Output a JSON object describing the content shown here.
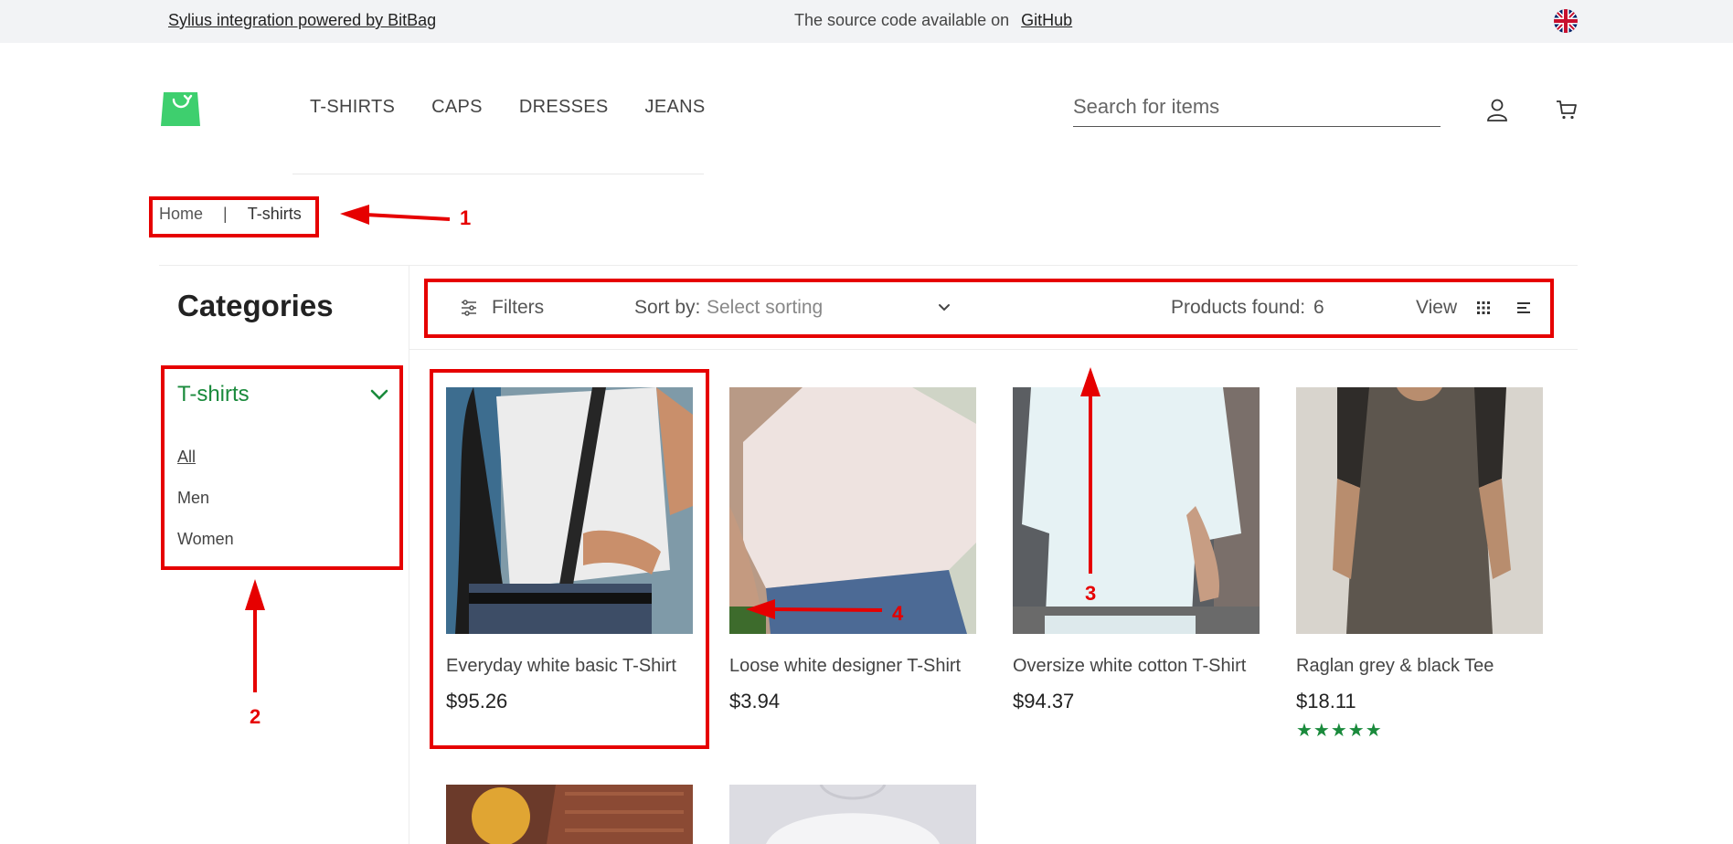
{
  "topbar": {
    "left_link": "Sylius integration powered by BitBag",
    "center_text": "The source code available on",
    "center_link": "GitHub",
    "language_icon": "uk-flag-icon"
  },
  "header": {
    "logo_icon": "shopping-bag-logo-icon",
    "nav": [
      "T-SHIRTS",
      "CAPS",
      "DRESSES",
      "JEANS"
    ],
    "search_placeholder": "Search for items",
    "account_icon": "user-icon",
    "cart_icon": "cart-icon"
  },
  "breadcrumb": {
    "home": "Home",
    "separator": "|",
    "current": "T-shirts"
  },
  "sidebar": {
    "title": "Categories",
    "group": "T-shirts",
    "items": [
      "All",
      "Men",
      "Women"
    ],
    "active_item": "All"
  },
  "toolbar": {
    "filters_label": "Filters",
    "sort_label": "Sort by:",
    "sort_value": "Select sorting",
    "products_found_label": "Products found:",
    "products_found_count": "6",
    "view_label": "View"
  },
  "products": [
    {
      "name": "Everyday white basic T-Shirt",
      "price": "$95.26"
    },
    {
      "name": "Loose white designer T-Shirt",
      "price": "$3.94"
    },
    {
      "name": "Oversize white cotton T-Shirt",
      "price": "$94.37"
    },
    {
      "name": "Raglan grey & black Tee",
      "price": "$18.11",
      "rating": "★★★★★"
    }
  ],
  "annotations": [
    "1",
    "2",
    "3",
    "4"
  ],
  "colors": {
    "accent_green": "#1a8a3c",
    "annotation_red": "#e60000",
    "topbar_bg": "#f2f3f5"
  }
}
